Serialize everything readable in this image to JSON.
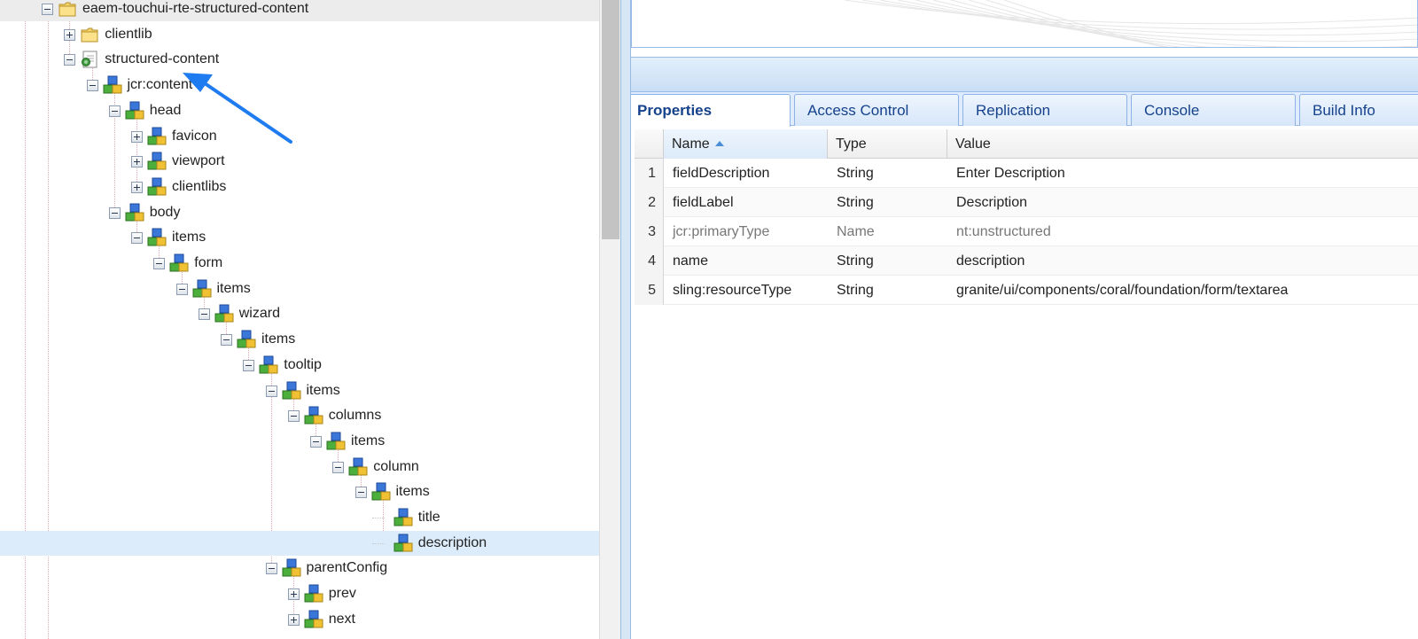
{
  "tree": {
    "nodes": [
      {
        "label": "eaem-touchui-rte-structured-content",
        "depth": 0,
        "toggle": "minus",
        "icon": "folder-icon",
        "highlight": "grey"
      },
      {
        "label": "clientlib",
        "depth": 1,
        "toggle": "plus",
        "icon": "folder-icon"
      },
      {
        "label": "structured-content",
        "depth": 1,
        "toggle": "minus",
        "icon": "page-icon"
      },
      {
        "label": "jcr:content",
        "depth": 2,
        "toggle": "minus",
        "icon": "node-icon"
      },
      {
        "label": "head",
        "depth": 3,
        "toggle": "minus",
        "icon": "node-icon"
      },
      {
        "label": "favicon",
        "depth": 4,
        "toggle": "plus",
        "icon": "node-icon"
      },
      {
        "label": "viewport",
        "depth": 4,
        "toggle": "plus",
        "icon": "node-icon"
      },
      {
        "label": "clientlibs",
        "depth": 4,
        "toggle": "plus",
        "icon": "node-icon"
      },
      {
        "label": "body",
        "depth": 3,
        "toggle": "minus",
        "icon": "node-icon"
      },
      {
        "label": "items",
        "depth": 4,
        "toggle": "minus",
        "icon": "node-icon"
      },
      {
        "label": "form",
        "depth": 5,
        "toggle": "minus",
        "icon": "node-icon"
      },
      {
        "label": "items",
        "depth": 6,
        "toggle": "minus",
        "icon": "node-icon"
      },
      {
        "label": "wizard",
        "depth": 7,
        "toggle": "minus",
        "icon": "node-icon"
      },
      {
        "label": "items",
        "depth": 8,
        "toggle": "minus",
        "icon": "node-icon"
      },
      {
        "label": "tooltip",
        "depth": 9,
        "toggle": "minus",
        "icon": "node-icon"
      },
      {
        "label": "items",
        "depth": 10,
        "toggle": "minus",
        "icon": "node-icon"
      },
      {
        "label": "columns",
        "depth": 11,
        "toggle": "minus",
        "icon": "node-icon"
      },
      {
        "label": "items",
        "depth": 12,
        "toggle": "minus",
        "icon": "node-icon"
      },
      {
        "label": "column",
        "depth": 13,
        "toggle": "minus",
        "icon": "node-icon"
      },
      {
        "label": "items",
        "depth": 14,
        "toggle": "minus",
        "icon": "node-icon"
      },
      {
        "label": "title",
        "depth": 15,
        "toggle": "none",
        "icon": "node-icon"
      },
      {
        "label": "description",
        "depth": 15,
        "toggle": "none",
        "icon": "node-icon",
        "highlight": "blue"
      },
      {
        "label": "parentConfig",
        "depth": 10,
        "toggle": "minus",
        "icon": "node-icon"
      },
      {
        "label": "prev",
        "depth": 11,
        "toggle": "plus",
        "icon": "node-icon"
      },
      {
        "label": "next",
        "depth": 11,
        "toggle": "plus",
        "icon": "node-icon"
      }
    ]
  },
  "tabs": [
    {
      "label": "Properties",
      "active": true
    },
    {
      "label": "Access Control",
      "active": false
    },
    {
      "label": "Replication",
      "active": false
    },
    {
      "label": "Console",
      "active": false
    },
    {
      "label": "Build Info",
      "active": false
    }
  ],
  "grid": {
    "columns": {
      "name": "Name",
      "type": "Type",
      "value": "Value"
    },
    "rows": [
      {
        "num": "1",
        "name": "fieldDescription",
        "type": "String",
        "value": "Enter Description",
        "muted": false
      },
      {
        "num": "2",
        "name": "fieldLabel",
        "type": "String",
        "value": "Description",
        "muted": false
      },
      {
        "num": "3",
        "name": "jcr:primaryType",
        "type": "Name",
        "value": "nt:unstructured",
        "muted": true
      },
      {
        "num": "4",
        "name": "name",
        "type": "String",
        "value": "description",
        "muted": false
      },
      {
        "num": "5",
        "name": "sling:resourceType",
        "type": "String",
        "value": "granite/ui/components/coral/foundation/form/textarea",
        "muted": false
      }
    ]
  },
  "colors": {
    "accent": "#15428b",
    "arrow": "#1e7bf0",
    "selection": "#dcecfb",
    "panel_border": "#99bbe8"
  }
}
